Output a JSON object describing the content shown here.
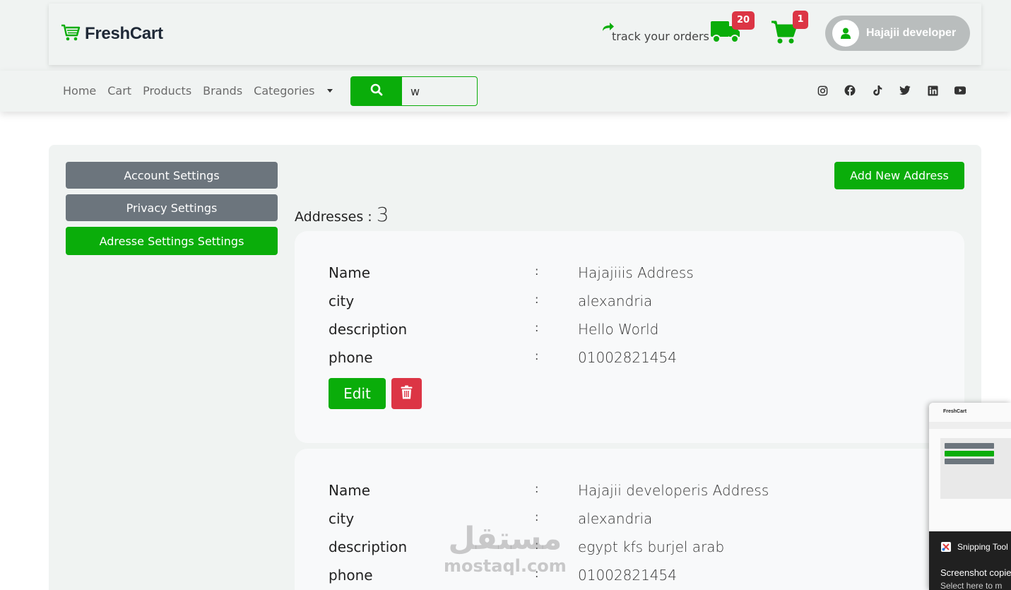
{
  "header": {
    "brand": "FreshCart",
    "track_label": "track your orders",
    "orders_badge": "20",
    "cart_badge": "1",
    "user_name": "Hajajii developer"
  },
  "nav": {
    "links": [
      "Home",
      "Cart",
      "Products",
      "Brands",
      "Categories"
    ],
    "search_value": "w",
    "socials": [
      "instagram-icon",
      "facebook-icon",
      "tiktok-icon",
      "twitter-icon",
      "linkedin-icon",
      "youtube-icon"
    ]
  },
  "sidebar": {
    "items": [
      {
        "label": "Account Settings",
        "active": false
      },
      {
        "label": "Privacy Settings",
        "active": false
      },
      {
        "label": "Adresse Settings Settings",
        "active": true
      }
    ]
  },
  "main": {
    "add_button": "Add New Address",
    "count_label": "Addresses :",
    "count_value": "3",
    "field_labels": {
      "name": "Name",
      "city": "city",
      "description": "description",
      "phone": "phone"
    },
    "separator": ":",
    "edit_label": "Edit",
    "addresses": [
      {
        "name": "Hajajiiis Address",
        "city": "alexandria",
        "description": "Hello World",
        "phone": "01002821454"
      },
      {
        "name": "Hajajii developeris Address",
        "city": "alexandria",
        "description": "egypt kfs burjel arab",
        "phone": "01002821454"
      }
    ]
  },
  "watermark": {
    "arabic": "مستقل",
    "latin": "mostaql.com"
  },
  "snipping_tool": {
    "app_name": "Snipping Tool",
    "thumb_brand": "FreshCart",
    "message": "Screenshot copie",
    "action": "Select here to m"
  },
  "colors": {
    "primary": "#0aad0a",
    "danger": "#dc3545",
    "secondary": "#6c757d",
    "header_bg": "#f0f3f2"
  }
}
